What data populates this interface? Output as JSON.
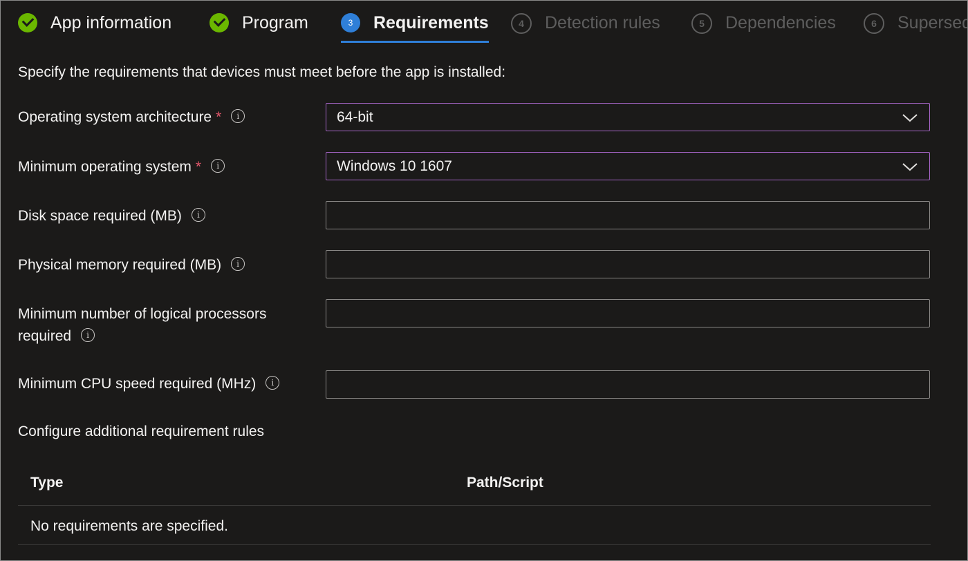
{
  "tabs": [
    {
      "label": "App information",
      "state": "done"
    },
    {
      "label": "Program",
      "state": "done"
    },
    {
      "label": "Requirements",
      "state": "active",
      "number": "3"
    },
    {
      "label": "Detection rules",
      "state": "disabled",
      "number": "4"
    },
    {
      "label": "Dependencies",
      "state": "disabled",
      "number": "5"
    },
    {
      "label": "Supersed",
      "state": "disabled",
      "number": "6"
    }
  ],
  "description": "Specify the requirements that devices must meet before the app is installed:",
  "fields": {
    "os_architecture": {
      "label": "Operating system architecture",
      "required_mark": "*",
      "value": "64-bit"
    },
    "min_os": {
      "label": "Minimum operating system",
      "required_mark": "*",
      "value": "Windows 10 1607"
    },
    "disk_space": {
      "label": "Disk space required (MB)",
      "value": ""
    },
    "physical_memory": {
      "label": "Physical memory required (MB)",
      "value": ""
    },
    "logical_processors": {
      "label_line1": "Minimum number of logical processors",
      "label_line2": "required",
      "value": ""
    },
    "cpu_speed": {
      "label": "Minimum CPU speed required (MHz)",
      "value": ""
    }
  },
  "info_glyph": "i",
  "additional_rules_heading": "Configure additional requirement rules",
  "table": {
    "columns": [
      "Type",
      "Path/Script"
    ],
    "empty_message": "No requirements are specified."
  },
  "colors": {
    "background": "#1b1a19",
    "accent_blue": "#2f7fd8",
    "success_green": "#6bb700",
    "focus_border": "#a665c7",
    "required_red": "#e0566a"
  },
  "icons": [
    "checkmark-circle-icon",
    "info-icon",
    "chevron-down-icon"
  ]
}
